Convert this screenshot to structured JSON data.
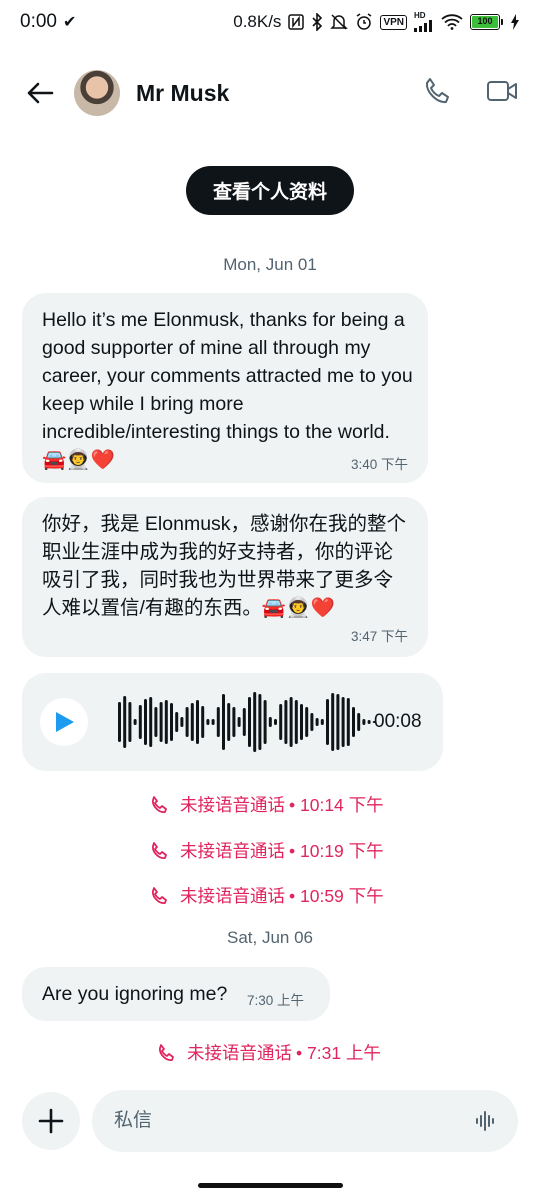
{
  "status_bar": {
    "time": "0:00",
    "network_speed": "0.8K/s",
    "vpn_label": "VPN",
    "signal_label": "HD",
    "battery_level": "100"
  },
  "header": {
    "contact_name": "Mr Musk"
  },
  "profile_button_label": "查看个人资料",
  "conversation": {
    "date_1": "Mon, Jun 01",
    "message_1": {
      "text": "Hello it’s me Elonmusk, thanks for being a good supporter of mine all through my career, your comments attracted me to you keep while I bring more incredible/interesting things to the world.🚘👨‍🚀❤️",
      "time": "3:40 下午"
    },
    "message_2": {
      "text": "你好，我是 Elonmusk，感谢你在我的整个职业生涯中成为我的好支持者，你的评论吸引了我，同时我也为世界带来了更多令人难以置信/有趣的东西。🚘👨‍🚀❤️",
      "time": "3:47 下午"
    },
    "voice_message": {
      "duration": "00:08"
    },
    "missed_calls_day1": [
      {
        "label": "未接语音通话",
        "time": "10:14 下午"
      },
      {
        "label": "未接语音通话",
        "time": "10:19 下午"
      },
      {
        "label": "未接语音通话",
        "time": "10:59 下午"
      }
    ],
    "date_2": "Sat, Jun 06",
    "message_3": {
      "text": "Are you ignoring me?",
      "time": "7:30 上午"
    },
    "missed_call_day2": {
      "label": "未接语音通话",
      "time": "7:31 上午"
    }
  },
  "composer": {
    "placeholder": "私信"
  },
  "colors": {
    "accent_missed_call": "#e0245e",
    "bubble_bg": "#eff3f4",
    "profile_button_bg": "#0f1419",
    "play_icon": "#1d9bf0"
  }
}
